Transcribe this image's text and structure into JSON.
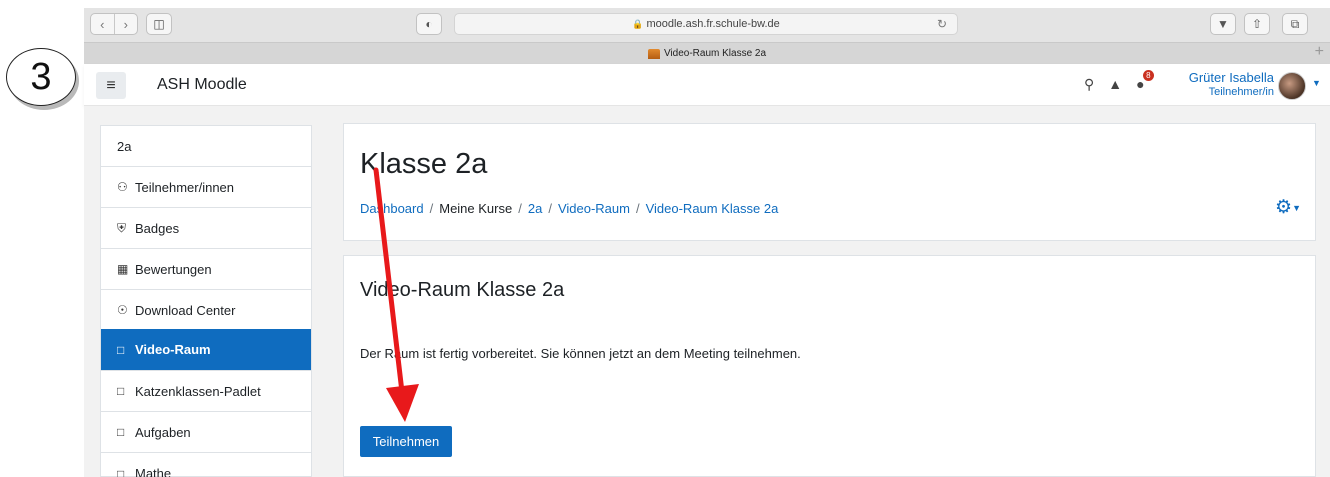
{
  "step_label": "3",
  "browser": {
    "url": "moodle.ash.fr.schule-bw.de",
    "tab_title": "Video-Raum Klasse 2a"
  },
  "navbar": {
    "brand": "ASH Moodle",
    "message_count": "8",
    "user_name": "Grüter Isabella",
    "user_role": "Teilnehmer/in"
  },
  "drawer": {
    "items": [
      {
        "label": "2a",
        "icon": "none"
      },
      {
        "label": "Teilnehmer/innen",
        "icon": "users-icon"
      },
      {
        "label": "Badges",
        "icon": "shield-icon"
      },
      {
        "label": "Bewertungen",
        "icon": "table-icon"
      },
      {
        "label": "Download Center",
        "icon": "download-icon"
      },
      {
        "label": "Video-Raum",
        "icon": "folder-icon",
        "active": true
      },
      {
        "label": "Katzenklassen-Padlet",
        "icon": "folder-icon"
      },
      {
        "label": "Aufgaben",
        "icon": "folder-icon"
      },
      {
        "label": "Mathe",
        "icon": "folder-icon"
      }
    ]
  },
  "header": {
    "title": "Klasse 2a",
    "breadcrumb": [
      "Dashboard",
      "Meine Kurse",
      "2a",
      "Video-Raum",
      "Video-Raum Klasse 2a"
    ]
  },
  "main": {
    "heading": "Video-Raum Klasse 2a",
    "message": "Der Raum ist fertig vorbereitet. Sie können jetzt an dem Meeting teilnehmen.",
    "join_button": "Teilnehmen"
  },
  "colors": {
    "accent": "#0f6cbf",
    "annotation_arrow": "#e8191b"
  }
}
